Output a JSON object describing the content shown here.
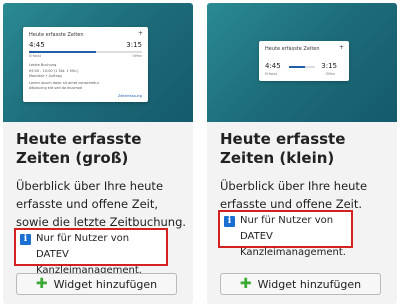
{
  "cards": [
    {
      "title": "Heute erfasste Zeiten (groß)",
      "description": "Überblick über Ihre heute erfasste und offene Zeit, sowie die letzte Zeitbuchung.",
      "notice": "Nur für Nutzer von DATEV Kanzleimanagement.",
      "button_label": "Widget hinzufügen",
      "preview": {
        "title": "Heute erfasste Zeiten",
        "plus": "+",
        "time_left": "4:45",
        "time_right": "3:15",
        "label_left": "Erfasst",
        "label_right": "Offen",
        "line1": "Letzte Buchung",
        "line2": "09:00 - 10:00 (1 Std. 1 Min.)",
        "line3": "Mandant • Auftrag",
        "line4": "Lorem ipsum dolor sit amet consectetur",
        "line5": "adipiscing elit sed do eiusmod",
        "link": "Zeiterfassung"
      }
    },
    {
      "title": "Heute erfasste Zeiten (klein)",
      "description": "Überblick über Ihre heute erfasste und offene Zeit.",
      "notice": "Nur für Nutzer von DATEV Kanzleimanagement.",
      "button_label": "Widget hinzufügen",
      "preview": {
        "title": "Heute erfasste Zeiten",
        "plus": "+",
        "time_left": "4:45",
        "time_right": "3:15",
        "label_left": "Erfasst",
        "label_right": "Offen"
      }
    }
  ],
  "icons": {
    "info": "info-icon",
    "plus": "plus-icon"
  }
}
